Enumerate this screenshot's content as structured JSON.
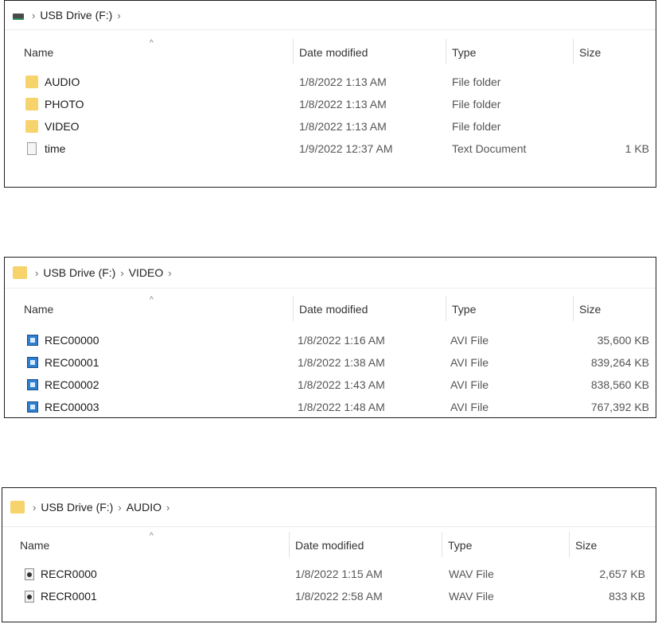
{
  "panels": [
    {
      "crumbs": [
        "USB Drive (F:)"
      ],
      "root_icon": "drive-icon",
      "columns": {
        "name": "Name",
        "date": "Date modified",
        "type": "Type",
        "size": "Size"
      },
      "rows": [
        {
          "name": "AUDIO",
          "date": "1/8/2022 1:13 AM",
          "type": "File folder",
          "size": "",
          "icon": "folder-icon"
        },
        {
          "name": "PHOTO",
          "date": "1/8/2022 1:13 AM",
          "type": "File folder",
          "size": "",
          "icon": "folder-icon"
        },
        {
          "name": "VIDEO",
          "date": "1/8/2022 1:13 AM",
          "type": "File folder",
          "size": "",
          "icon": "folder-icon"
        },
        {
          "name": "time",
          "date": "1/9/2022 12:37 AM",
          "type": "Text Document",
          "size": "1 KB",
          "icon": "text-document-icon"
        }
      ]
    },
    {
      "crumbs": [
        "USB Drive (F:)",
        "VIDEO"
      ],
      "root_icon": "folder-icon",
      "columns": {
        "name": "Name",
        "date": "Date modified",
        "type": "Type",
        "size": "Size"
      },
      "rows": [
        {
          "name": "REC00000",
          "date": "1/8/2022 1:16 AM",
          "type": "AVI File",
          "size": "35,600 KB",
          "icon": "avi-file-icon"
        },
        {
          "name": "REC00001",
          "date": "1/8/2022 1:38 AM",
          "type": "AVI File",
          "size": "839,264 KB",
          "icon": "avi-file-icon"
        },
        {
          "name": "REC00002",
          "date": "1/8/2022 1:43 AM",
          "type": "AVI File",
          "size": "838,560 KB",
          "icon": "avi-file-icon"
        },
        {
          "name": "REC00003",
          "date": "1/8/2022 1:48 AM",
          "type": "AVI File",
          "size": "767,392 KB",
          "icon": "avi-file-icon"
        }
      ]
    },
    {
      "crumbs": [
        "USB Drive (F:)",
        "AUDIO"
      ],
      "root_icon": "folder-icon",
      "columns": {
        "name": "Name",
        "date": "Date modified",
        "type": "Type",
        "size": "Size"
      },
      "rows": [
        {
          "name": "RECR0000",
          "date": "1/8/2022 1:15 AM",
          "type": "WAV File",
          "size": "2,657 KB",
          "icon": "wav-file-icon"
        },
        {
          "name": "RECR0001",
          "date": "1/8/2022 2:58 AM",
          "type": "WAV File",
          "size": "833 KB",
          "icon": "wav-file-icon"
        }
      ]
    }
  ]
}
